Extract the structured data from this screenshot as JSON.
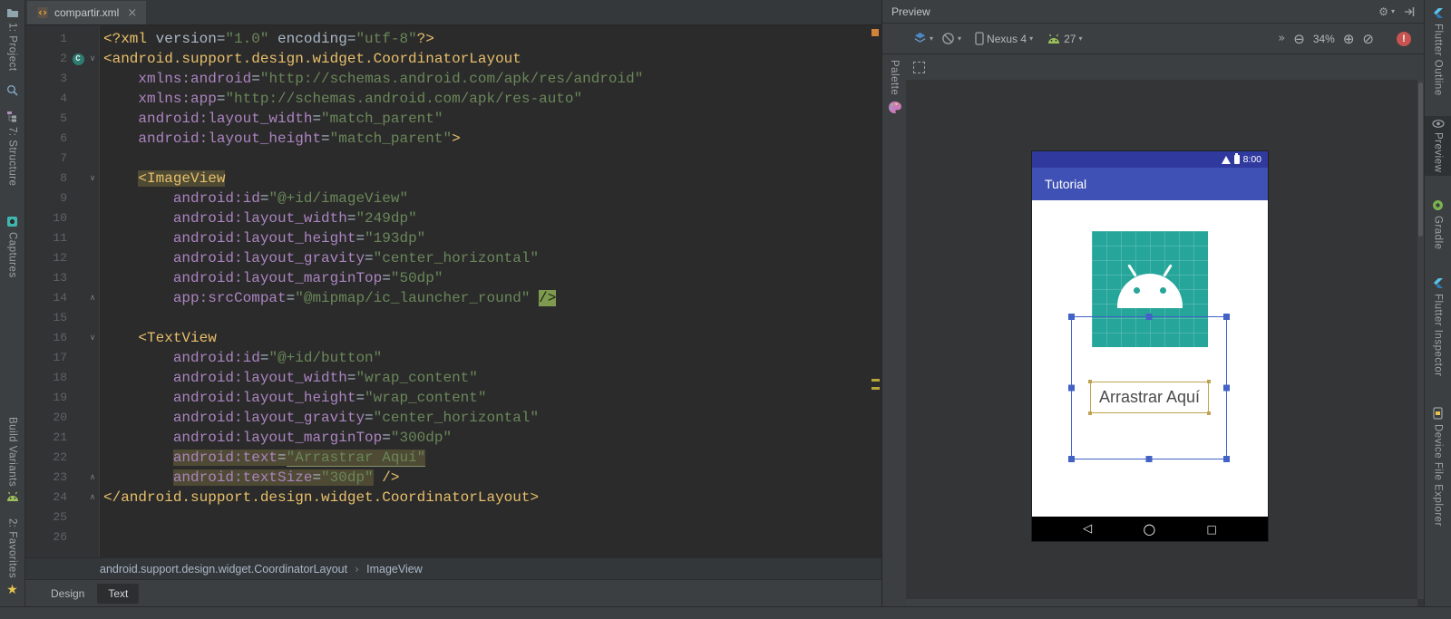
{
  "glyphs": {
    "close": "×",
    "caret": "▾",
    "gear": "⚙",
    "zoom_out": "⊖",
    "zoom_in": "⊕",
    "zoom_fit": "⊘",
    "overflow": "»",
    "error": "!",
    "star": "★",
    "back": "◁",
    "home": "○",
    "recents": "□",
    "sep": "›"
  },
  "left_strip": {
    "project": "1: Project",
    "structure": "7: Structure",
    "captures": "Captures",
    "build_variants": "Build Variants",
    "favorites": "2: Favorites"
  },
  "right_strip": {
    "flutter_outline": "Flutter Outline",
    "preview": "Preview",
    "gradle": "Gradle",
    "flutter_inspector": "Flutter Inspector",
    "device_file_explorer": "Device File Explorer"
  },
  "editor": {
    "tab_title": "compartir.xml",
    "breadcrumbs": [
      "android.support.design.widget.CoordinatorLayout",
      "ImageView"
    ],
    "view_tabs": {
      "design": "Design",
      "text": "Text"
    },
    "gutter": {
      "fold_start": [
        2,
        8,
        16
      ],
      "fold_end": [
        14,
        23,
        24
      ],
      "fold_start_glyph": "∨",
      "fold_end_glyph": "∧",
      "class_icon_line": 2,
      "class_icon_text": "C"
    },
    "lines": [
      [
        [
          "tag",
          "<?xml "
        ],
        [
          "pln",
          "version="
        ],
        [
          "str",
          "\"1.0\""
        ],
        [
          "pln",
          " encoding="
        ],
        [
          "str",
          "\"utf-8\""
        ],
        [
          "tag",
          "?>"
        ]
      ],
      [
        [
          "tag",
          "<android.support.design.widget.CoordinatorLayout"
        ]
      ],
      [
        [
          "pln",
          "    "
        ],
        [
          "attr",
          "xmlns:android"
        ],
        [
          "pln",
          "="
        ],
        [
          "str",
          "\"http://schemas.android.com/apk/res/android\""
        ]
      ],
      [
        [
          "pln",
          "    "
        ],
        [
          "attr",
          "xmlns:app"
        ],
        [
          "pln",
          "="
        ],
        [
          "str",
          "\"http://schemas.android.com/apk/res-auto\""
        ]
      ],
      [
        [
          "pln",
          "    "
        ],
        [
          "attr",
          "android:layout_width"
        ],
        [
          "pln",
          "="
        ],
        [
          "str",
          "\"match_parent\""
        ]
      ],
      [
        [
          "pln",
          "    "
        ],
        [
          "attr",
          "android:layout_height"
        ],
        [
          "pln",
          "="
        ],
        [
          "str",
          "\"match_parent\""
        ],
        [
          "tag",
          ">"
        ]
      ],
      [],
      [
        [
          "pln",
          "    "
        ],
        [
          "tag hl8",
          "<ImageView"
        ]
      ],
      [
        [
          "pln",
          "        "
        ],
        [
          "attr",
          "android:id"
        ],
        [
          "pln",
          "="
        ],
        [
          "str",
          "\"@+id/imageView\""
        ]
      ],
      [
        [
          "pln",
          "        "
        ],
        [
          "attr",
          "android:layout_width"
        ],
        [
          "pln",
          "="
        ],
        [
          "str",
          "\"249dp\""
        ]
      ],
      [
        [
          "pln",
          "        "
        ],
        [
          "attr",
          "android:layout_height"
        ],
        [
          "pln",
          "="
        ],
        [
          "str",
          "\"193dp\""
        ]
      ],
      [
        [
          "pln",
          "        "
        ],
        [
          "attr",
          "android:layout_gravity"
        ],
        [
          "pln",
          "="
        ],
        [
          "str",
          "\"center_horizontal\""
        ]
      ],
      [
        [
          "pln",
          "        "
        ],
        [
          "attr",
          "android:layout_marginTop"
        ],
        [
          "pln",
          "="
        ],
        [
          "str",
          "\"50dp\""
        ]
      ],
      [
        [
          "pln",
          "        "
        ],
        [
          "attr",
          "app:srcCompat"
        ],
        [
          "pln",
          "="
        ],
        [
          "str",
          "\"@mipmap/ic_launcher_round\""
        ],
        [
          "pln",
          " "
        ],
        [
          "cl14",
          "/>"
        ]
      ],
      [],
      [
        [
          "pln",
          "    "
        ],
        [
          "tag",
          "<TextView"
        ]
      ],
      [
        [
          "pln",
          "        "
        ],
        [
          "attr",
          "android:id"
        ],
        [
          "pln",
          "="
        ],
        [
          "str",
          "\"@+id/button\""
        ]
      ],
      [
        [
          "pln",
          "        "
        ],
        [
          "attr",
          "android:layout_width"
        ],
        [
          "pln",
          "="
        ],
        [
          "str",
          "\"wrap_content\""
        ]
      ],
      [
        [
          "pln",
          "        "
        ],
        [
          "attr",
          "android:layout_height"
        ],
        [
          "pln",
          "="
        ],
        [
          "str",
          "\"wrap_content\""
        ]
      ],
      [
        [
          "pln",
          "        "
        ],
        [
          "attr",
          "android:layout_gravity"
        ],
        [
          "pln",
          "="
        ],
        [
          "str",
          "\"center_horizontal\""
        ]
      ],
      [
        [
          "pln",
          "        "
        ],
        [
          "attr",
          "android:layout_marginTop"
        ],
        [
          "pln",
          "="
        ],
        [
          "str",
          "\"300dp\""
        ]
      ],
      [
        [
          "pln",
          "        "
        ],
        [
          "attr hl22",
          "android:text"
        ],
        [
          "pln hl22",
          "="
        ],
        [
          "str hl22 u",
          "\"Arrastrar Aquí\""
        ]
      ],
      [
        [
          "pln",
          "        "
        ],
        [
          "attr hl22",
          "android:textSize"
        ],
        [
          "pln hl22",
          "="
        ],
        [
          "str hl22",
          "\"30dp\""
        ],
        [
          "pln",
          " "
        ],
        [
          "tag",
          "/>"
        ]
      ],
      [
        [
          "tag",
          "</android.support.design.widget.CoordinatorLayout>"
        ]
      ],
      [],
      []
    ]
  },
  "preview": {
    "title": "Preview",
    "palette_label": "Palette",
    "toolbar": {
      "device": "Nexus 4",
      "api": "27",
      "zoom": "34%"
    },
    "device_screen": {
      "time": "8:00",
      "app_title": "Tutorial",
      "drag_text": "Arrastrar Aquí"
    }
  },
  "colors": {
    "app_bar": "#3F51B5",
    "status_bar": "#303A9E",
    "launcher_teal": "#26A69A",
    "selection_blue": "#4262C6",
    "text_bounds_yellow": "#BFA353",
    "error_red": "#C75450"
  }
}
